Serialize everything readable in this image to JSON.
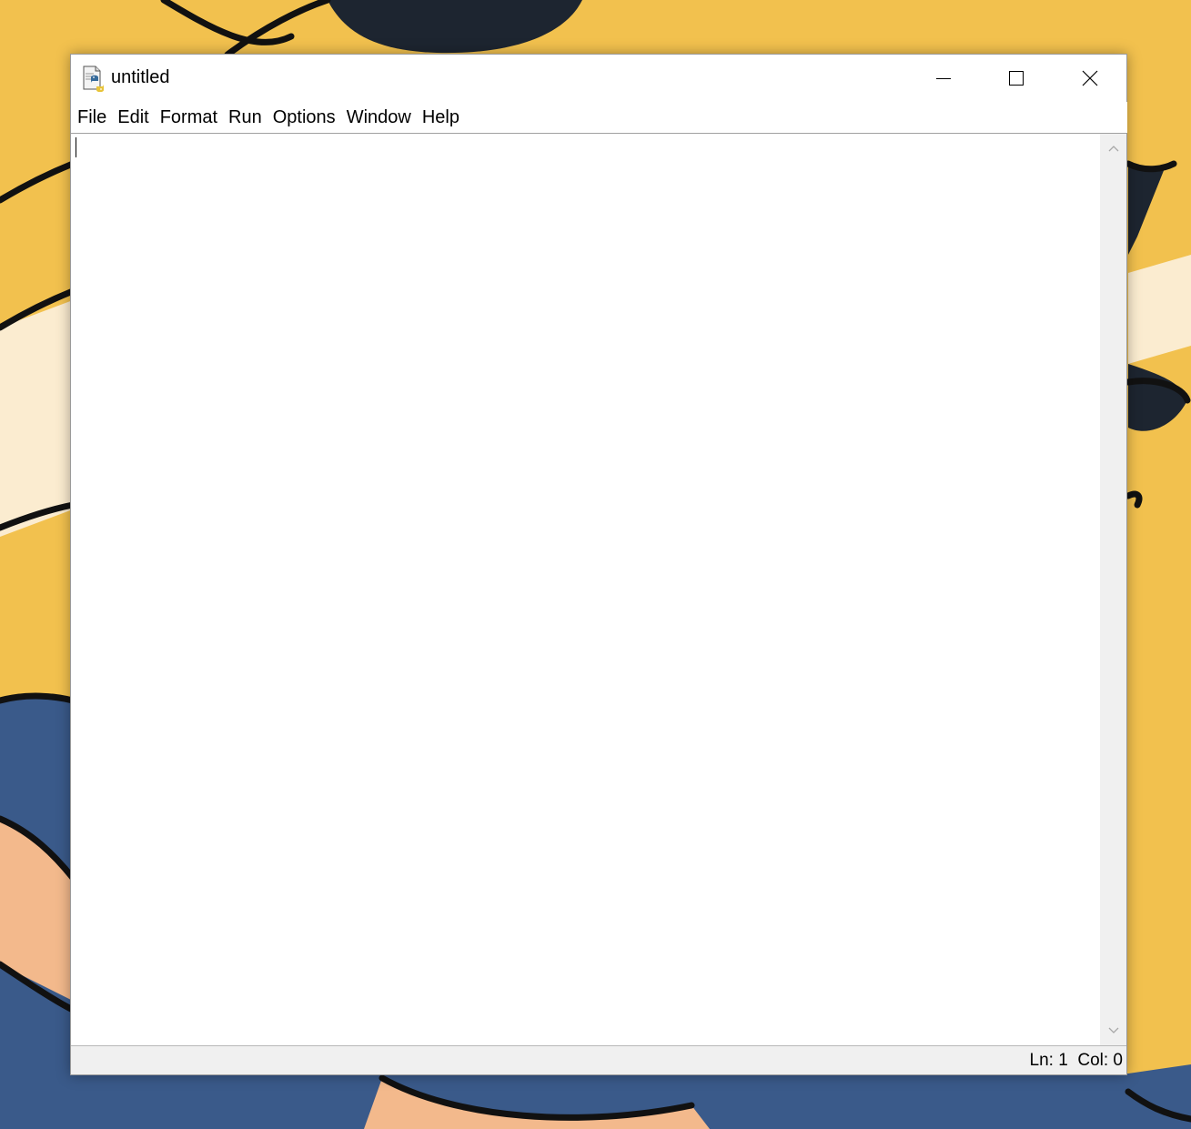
{
  "window": {
    "title": "untitled",
    "icon": "python-idle-file-icon",
    "minimize_icon": "minimize-icon",
    "maximize_icon": "maximize-icon",
    "close_icon": "close-icon"
  },
  "menu": {
    "items": [
      {
        "label": "File"
      },
      {
        "label": "Edit"
      },
      {
        "label": "Format"
      },
      {
        "label": "Run"
      },
      {
        "label": "Options"
      },
      {
        "label": "Window"
      },
      {
        "label": "Help"
      }
    ]
  },
  "editor": {
    "content": ""
  },
  "status": {
    "line": "Ln: 1",
    "col": "Col: 0"
  },
  "colors": {
    "wallpaper_yellow": "#f0c050",
    "wallpaper_blue": "#3a5a8a",
    "window_bg": "#ffffff",
    "statusbar_bg": "#f0f0f0"
  }
}
